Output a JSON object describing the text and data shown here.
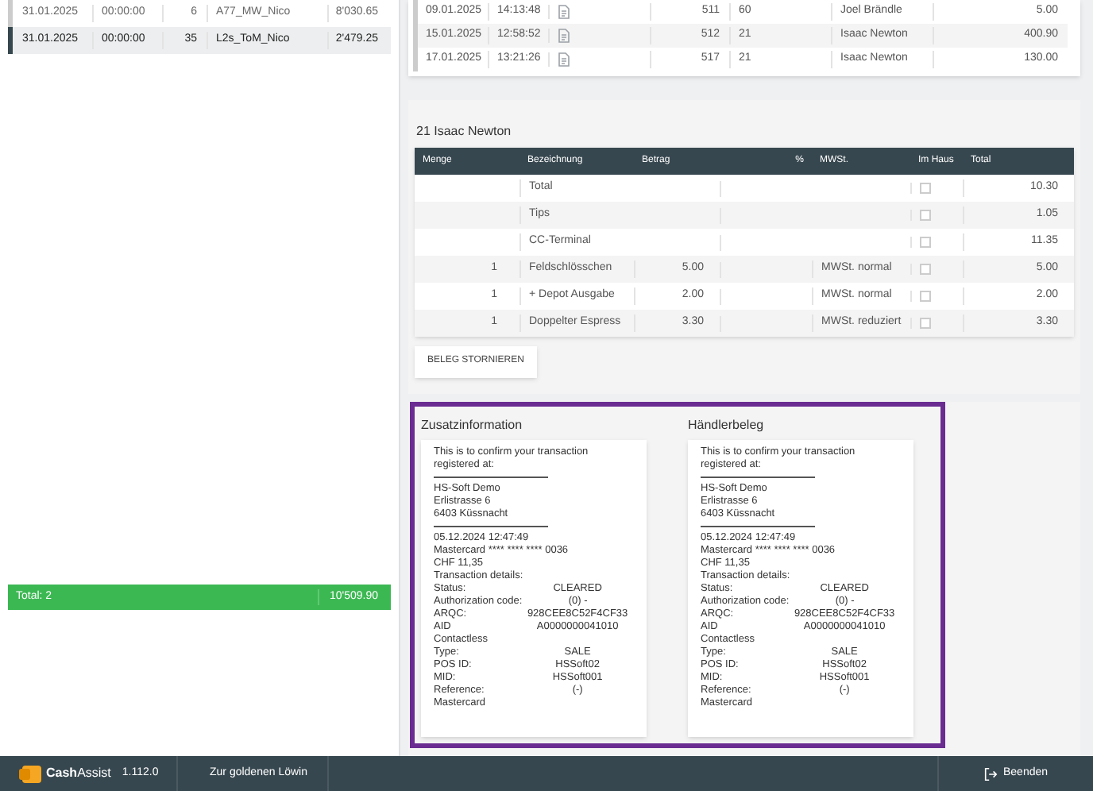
{
  "orders": [
    {
      "date": "31.01.2025",
      "time": "00:00:00",
      "number": "6",
      "name": "A77_MW_Nico",
      "amount": "8'030.65",
      "selected": false
    },
    {
      "date": "31.01.2025",
      "time": "00:00:00",
      "number": "35",
      "name": "L2s_ToM_Nico",
      "amount": "2'479.25",
      "selected": true
    }
  ],
  "orders_total": {
    "label": "Total: 2",
    "amount": "10'509.90"
  },
  "receipts": [
    {
      "date": "09.01.2025",
      "time": "14:13:48",
      "number": "511",
      "table": "60",
      "waiter": "Joel Brändle",
      "amount": "5.00"
    },
    {
      "date": "15.01.2025",
      "time": "12:58:52",
      "number": "512",
      "table": "21",
      "waiter": "Isaac Newton",
      "amount": "400.90"
    },
    {
      "date": "17.01.2025",
      "time": "13:21:26",
      "number": "517",
      "table": "21",
      "waiter": "Isaac Newton",
      "amount": "130.00"
    }
  ],
  "detail": {
    "title": "21 Isaac Newton",
    "columns": [
      "Menge",
      "Bezeichnung",
      "Betrag",
      "%",
      "MWSt.",
      "Im Haus",
      "Total"
    ],
    "rows": [
      {
        "qty": "",
        "name": "Total",
        "price": "",
        "vat": "",
        "in_house": false,
        "total": "10.30"
      },
      {
        "qty": "",
        "name": "Tips",
        "price": "",
        "vat": "",
        "in_house": false,
        "total": "1.05"
      },
      {
        "qty": "",
        "name": "CC-Terminal",
        "price": "",
        "vat": "",
        "in_house": false,
        "total": "11.35"
      },
      {
        "qty": "1",
        "name": "Feldschlösschen",
        "price": "5.00",
        "vat": "MWSt. normal",
        "in_house": false,
        "total": "5.00"
      },
      {
        "qty": "1",
        "name": "+ Depot Ausgabe",
        "price": "2.00",
        "vat": "MWSt. normal",
        "in_house": false,
        "total": "2.00"
      },
      {
        "qty": "1",
        "name": "Doppelter Espress",
        "price": "3.30",
        "vat": "MWSt. reduziert",
        "in_house": false,
        "total": "3.30"
      }
    ],
    "cancel_button": "BELEG STORNIEREN"
  },
  "slips": [
    {
      "title": "Zusatzinformation",
      "lines": [
        {
          "kind": "text",
          "label": "This is to confirm your transaction"
        },
        {
          "kind": "text",
          "label": "registered at:"
        },
        {
          "kind": "rule"
        },
        {
          "kind": "text",
          "label": "HS-Soft Demo"
        },
        {
          "kind": "text",
          "label": "Erlistrasse 6"
        },
        {
          "kind": "text",
          "label": "6403 Küssnacht"
        },
        {
          "kind": "rule"
        },
        {
          "kind": "text",
          "label": "05.12.2024 12:47:49"
        },
        {
          "kind": "text",
          "label": "Mastercard **** **** **** 0036"
        },
        {
          "kind": "text",
          "label": "CHF  11,35"
        },
        {
          "kind": "text",
          "label": "Transaction details:"
        },
        {
          "kind": "pair",
          "label": "Status:",
          "value": "CLEARED"
        },
        {
          "kind": "pair",
          "label": "Authorization code:",
          "value": "(0) -"
        },
        {
          "kind": "pair",
          "label": "ARQC:",
          "value": "928CEE8C52F4CF33"
        },
        {
          "kind": "pair",
          "label": "AID",
          "value": "A0000000041010"
        },
        {
          "kind": "text",
          "label": "Contactless"
        },
        {
          "kind": "pair",
          "label": "Type:",
          "value": "SALE"
        },
        {
          "kind": "pair",
          "label": "POS ID:",
          "value": "HSSoft02"
        },
        {
          "kind": "pair",
          "label": "MID:",
          "value": "HSSoft001"
        },
        {
          "kind": "pair",
          "label": "Reference:",
          "value": "(-)"
        },
        {
          "kind": "text",
          "label": "Mastercard"
        }
      ]
    },
    {
      "title": "Händlerbeleg",
      "lines": [
        {
          "kind": "text",
          "label": "This is to confirm your transaction"
        },
        {
          "kind": "text",
          "label": "registered at:"
        },
        {
          "kind": "rule"
        },
        {
          "kind": "text",
          "label": "HS-Soft Demo"
        },
        {
          "kind": "text",
          "label": "Erlistrasse 6"
        },
        {
          "kind": "text",
          "label": "6403 Küssnacht"
        },
        {
          "kind": "rule"
        },
        {
          "kind": "text",
          "label": "05.12.2024 12:47:49"
        },
        {
          "kind": "text",
          "label": "Mastercard **** **** **** 0036"
        },
        {
          "kind": "text",
          "label": "CHF  11,35"
        },
        {
          "kind": "text",
          "label": "Transaction details:"
        },
        {
          "kind": "pair",
          "label": "Status:",
          "value": "CLEARED"
        },
        {
          "kind": "pair",
          "label": "Authorization code:",
          "value": "(0) -"
        },
        {
          "kind": "pair",
          "label": "ARQC:",
          "value": "928CEE8C52F4CF33"
        },
        {
          "kind": "pair",
          "label": "AID",
          "value": "A0000000041010"
        },
        {
          "kind": "text",
          "label": "Contactless"
        },
        {
          "kind": "pair",
          "label": "Type:",
          "value": "SALE"
        },
        {
          "kind": "pair",
          "label": "POS ID:",
          "value": "HSSoft02"
        },
        {
          "kind": "pair",
          "label": "MID:",
          "value": "HSSoft001"
        },
        {
          "kind": "pair",
          "label": "Reference:",
          "value": "(-)"
        },
        {
          "kind": "text",
          "label": "Mastercard"
        }
      ]
    }
  ],
  "status_bar": {
    "app_name": "Cash",
    "app_name_suffix": "Assist",
    "version": "1.112.0",
    "venue": "Zur goldenen Löwin",
    "exit": "Beenden"
  }
}
